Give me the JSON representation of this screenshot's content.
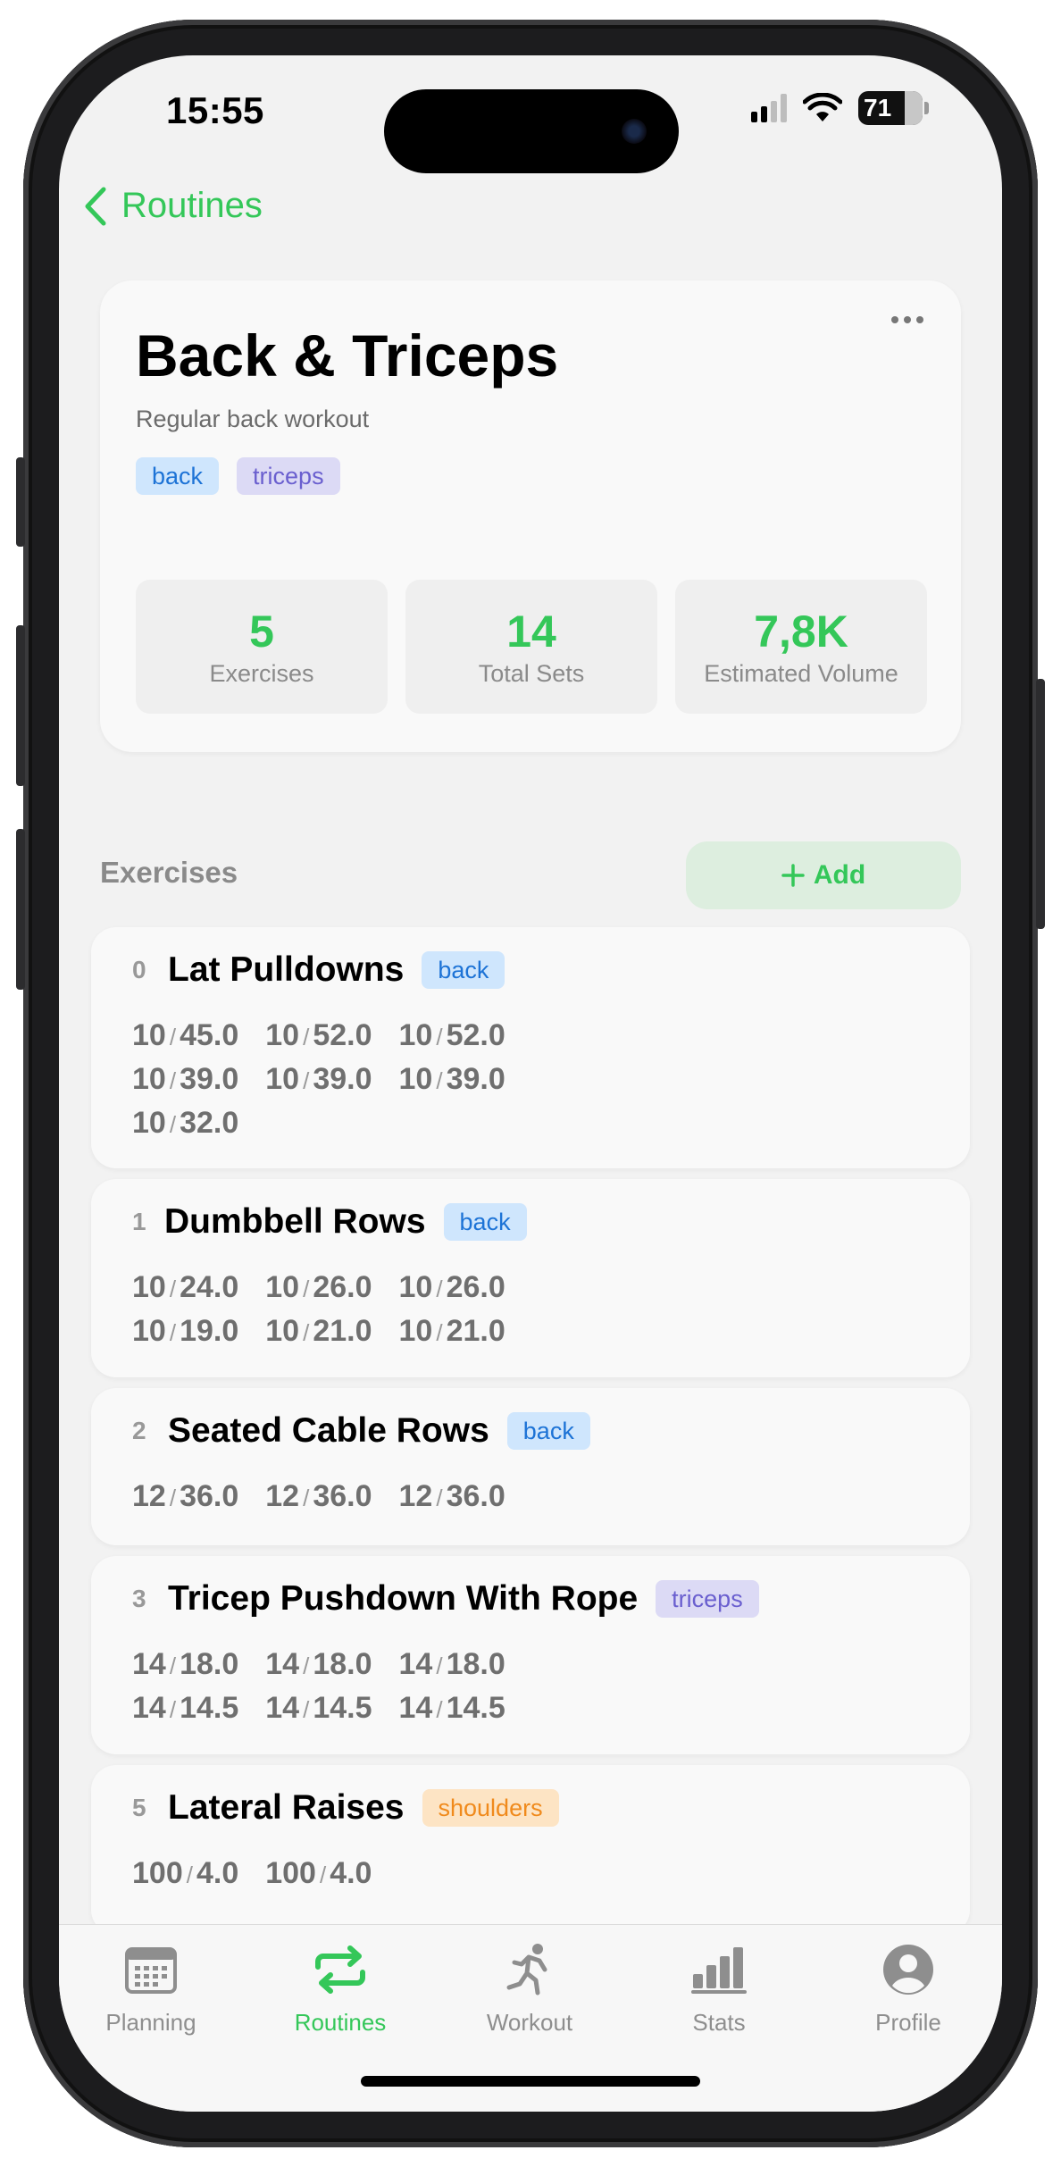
{
  "status_bar": {
    "time": "15:55",
    "battery": "71"
  },
  "nav": {
    "back_label": "Routines"
  },
  "routine": {
    "title": "Back & Triceps",
    "description": "Regular back workout",
    "tags": [
      "back",
      "triceps"
    ],
    "stats": [
      {
        "value": "5",
        "label": "Exercises"
      },
      {
        "value": "14",
        "label": "Total Sets"
      },
      {
        "value": "7,8K",
        "label": "Estimated Volume"
      }
    ]
  },
  "exercises_section": {
    "title": "Exercises",
    "add_label": "Add"
  },
  "exercises": [
    {
      "index": "0",
      "name": "Lat Pulldowns",
      "tag": "back",
      "sets": [
        [
          "10",
          "45.0"
        ],
        [
          "10",
          "52.0"
        ],
        [
          "10",
          "52.0"
        ],
        [
          "10",
          "39.0"
        ],
        [
          "10",
          "39.0"
        ],
        [
          "10",
          "39.0"
        ],
        [
          "10",
          "32.0"
        ]
      ]
    },
    {
      "index": "1",
      "name": "Dumbbell Rows",
      "tag": "back",
      "sets": [
        [
          "10",
          "24.0"
        ],
        [
          "10",
          "26.0"
        ],
        [
          "10",
          "26.0"
        ],
        [
          "10",
          "19.0"
        ],
        [
          "10",
          "21.0"
        ],
        [
          "10",
          "21.0"
        ]
      ]
    },
    {
      "index": "2",
      "name": "Seated Cable Rows",
      "tag": "back",
      "sets": [
        [
          "12",
          "36.0"
        ],
        [
          "12",
          "36.0"
        ],
        [
          "12",
          "36.0"
        ]
      ]
    },
    {
      "index": "3",
      "name": "Tricep Pushdown With Rope",
      "tag": "triceps",
      "sets": [
        [
          "14",
          "18.0"
        ],
        [
          "14",
          "18.0"
        ],
        [
          "14",
          "18.0"
        ],
        [
          "14",
          "14.5"
        ],
        [
          "14",
          "14.5"
        ],
        [
          "14",
          "14.5"
        ]
      ]
    },
    {
      "index": "5",
      "name": "Lateral Raises",
      "tag": "shoulders",
      "sets": [
        [
          "100",
          "4.0"
        ],
        [
          "100",
          "4.0"
        ]
      ]
    }
  ],
  "tab_bar": {
    "tabs": [
      {
        "label": "Planning",
        "icon": "calendar-icon"
      },
      {
        "label": "Routines",
        "icon": "repeat-icon"
      },
      {
        "label": "Workout",
        "icon": "running-icon"
      },
      {
        "label": "Stats",
        "icon": "bar-chart-icon"
      },
      {
        "label": "Profile",
        "icon": "person-icon"
      }
    ],
    "active": "Routines"
  },
  "colors": {
    "accent": "#34c759",
    "tag_back": "#1d73d6",
    "tag_triceps": "#6a5fcf",
    "tag_shoulders": "#f08a1c"
  }
}
